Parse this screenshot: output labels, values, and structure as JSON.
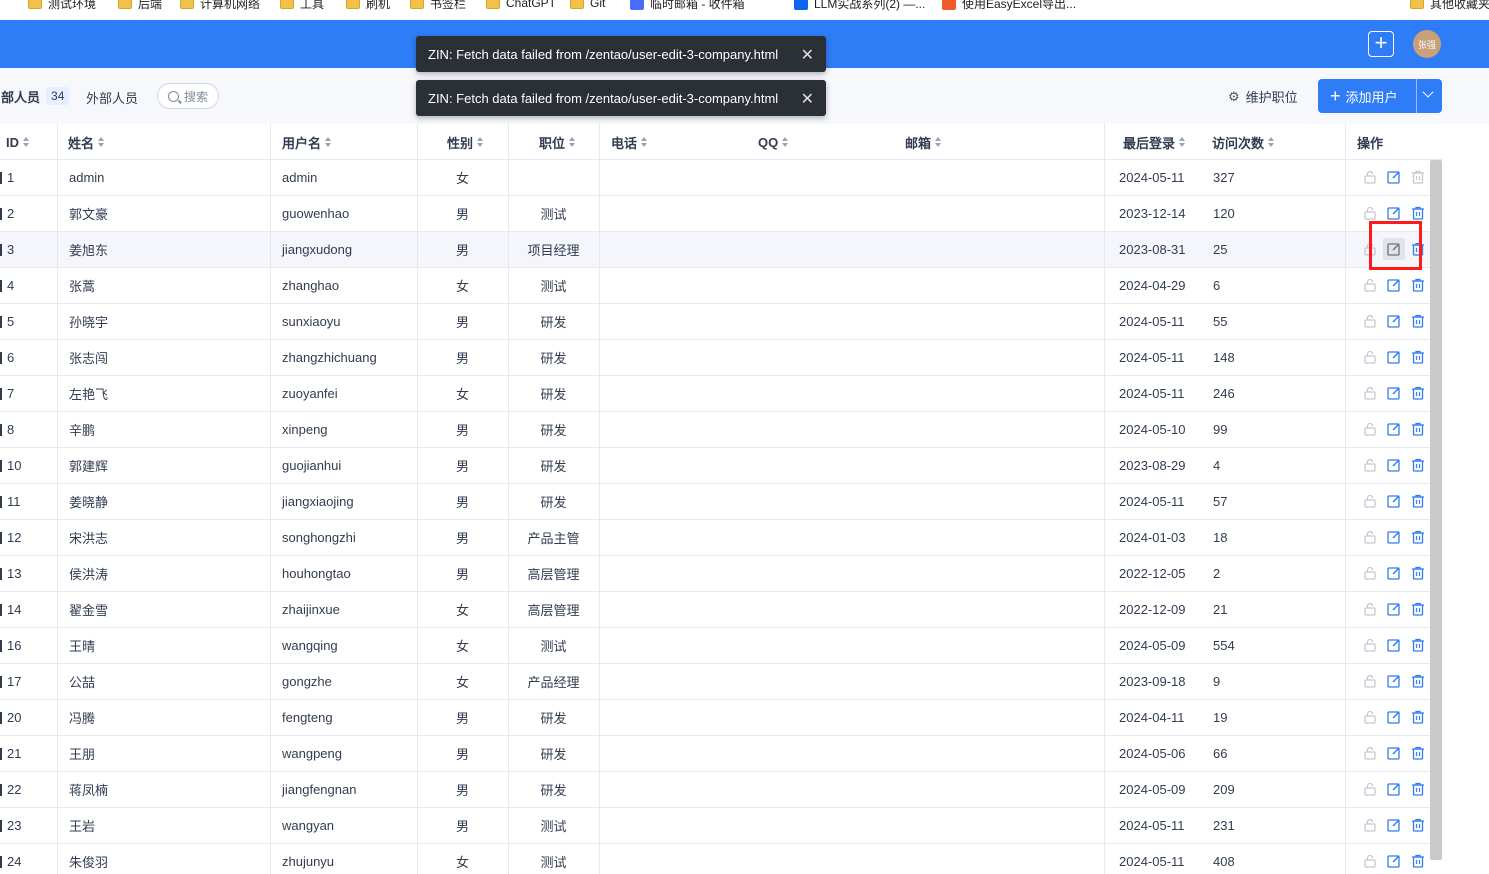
{
  "bookmarks": [
    "测试环境",
    "后端",
    "计算机网络",
    "工具",
    "刷机",
    "书签栏",
    "ChatGPT",
    "Git",
    "临时邮箱 - 收件箱",
    "LLM实战系列(2) —...",
    "使用EasyExcel导出...",
    "其他收藏夹"
  ],
  "header": {
    "avatar_text": "张强",
    "plus_icon": "plus-icon"
  },
  "toolbar": {
    "tab_internal": "内部人员",
    "internal_count": "34",
    "tab_external": "外部人员",
    "search_label": "搜索",
    "maintain_label": "维护职位",
    "add_user_label": "添加用户"
  },
  "toasts": [
    {
      "message": "ZIN: Fetch data failed from /zentao/user-edit-3-company.html"
    },
    {
      "message": "ZIN: Fetch data failed from /zentao/user-edit-3-company.html"
    }
  ],
  "table": {
    "columns": [
      "ID",
      "姓名",
      "用户名",
      "性别",
      "职位",
      "电话",
      "QQ",
      "邮箱",
      "最后登录",
      "访问次数",
      "操作"
    ],
    "rows": [
      {
        "id": "1",
        "name": "admin",
        "username": "admin",
        "gender": "女",
        "role": "",
        "last_login": "2024-05-11",
        "visits": "327"
      },
      {
        "id": "2",
        "name": "郭文豪",
        "username": "guowenhao",
        "gender": "男",
        "role": "测试",
        "last_login": "2023-12-14",
        "visits": "120"
      },
      {
        "id": "3",
        "name": "姜旭东",
        "username": "jiangxudong",
        "gender": "男",
        "role": "项目经理",
        "last_login": "2023-08-31",
        "visits": "25"
      },
      {
        "id": "4",
        "name": "张蒿",
        "username": "zhanghao",
        "gender": "女",
        "role": "测试",
        "last_login": "2024-04-29",
        "visits": "6"
      },
      {
        "id": "5",
        "name": "孙晓宇",
        "username": "sunxiaoyu",
        "gender": "男",
        "role": "研发",
        "last_login": "2024-05-11",
        "visits": "55"
      },
      {
        "id": "6",
        "name": "张志闯",
        "username": "zhangzhichuang",
        "gender": "男",
        "role": "研发",
        "last_login": "2024-05-11",
        "visits": "148"
      },
      {
        "id": "7",
        "name": "左艳飞",
        "username": "zuoyanfei",
        "gender": "女",
        "role": "研发",
        "last_login": "2024-05-11",
        "visits": "246"
      },
      {
        "id": "8",
        "name": "辛鹏",
        "username": "xinpeng",
        "gender": "男",
        "role": "研发",
        "last_login": "2024-05-10",
        "visits": "99"
      },
      {
        "id": "10",
        "name": "郭建辉",
        "username": "guojianhui",
        "gender": "男",
        "role": "研发",
        "last_login": "2023-08-29",
        "visits": "4"
      },
      {
        "id": "11",
        "name": "姜晓静",
        "username": "jiangxiaojing",
        "gender": "男",
        "role": "研发",
        "last_login": "2024-05-11",
        "visits": "57"
      },
      {
        "id": "12",
        "name": "宋洪志",
        "username": "songhongzhi",
        "gender": "男",
        "role": "产品主管",
        "last_login": "2024-01-03",
        "visits": "18"
      },
      {
        "id": "13",
        "name": "侯洪涛",
        "username": "houhongtao",
        "gender": "男",
        "role": "高层管理",
        "last_login": "2022-12-05",
        "visits": "2"
      },
      {
        "id": "14",
        "name": "翟金雪",
        "username": "zhaijinxue",
        "gender": "女",
        "role": "高层管理",
        "last_login": "2022-12-09",
        "visits": "21"
      },
      {
        "id": "16",
        "name": "王晴",
        "username": "wangqing",
        "gender": "女",
        "role": "测试",
        "last_login": "2024-05-09",
        "visits": "554"
      },
      {
        "id": "17",
        "name": "公喆",
        "username": "gongzhe",
        "gender": "女",
        "role": "产品经理",
        "last_login": "2023-09-18",
        "visits": "9"
      },
      {
        "id": "20",
        "name": "冯腾",
        "username": "fengteng",
        "gender": "男",
        "role": "研发",
        "last_login": "2024-04-11",
        "visits": "19"
      },
      {
        "id": "21",
        "name": "王朋",
        "username": "wangpeng",
        "gender": "男",
        "role": "研发",
        "last_login": "2024-05-06",
        "visits": "66"
      },
      {
        "id": "22",
        "name": "蒋凤楠",
        "username": "jiangfengnan",
        "gender": "男",
        "role": "研发",
        "last_login": "2024-05-09",
        "visits": "209"
      },
      {
        "id": "23",
        "name": "王岩",
        "username": "wangyan",
        "gender": "男",
        "role": "测试",
        "last_login": "2024-05-11",
        "visits": "231"
      },
      {
        "id": "24",
        "name": "朱俊羽",
        "username": "zhujunyu",
        "gender": "女",
        "role": "测试",
        "last_login": "2024-05-11",
        "visits": "408"
      }
    ]
  },
  "colors": {
    "primary": "#2e7df6",
    "toast_bg": "#2b2f36",
    "highlight": "#ff1a1a"
  }
}
